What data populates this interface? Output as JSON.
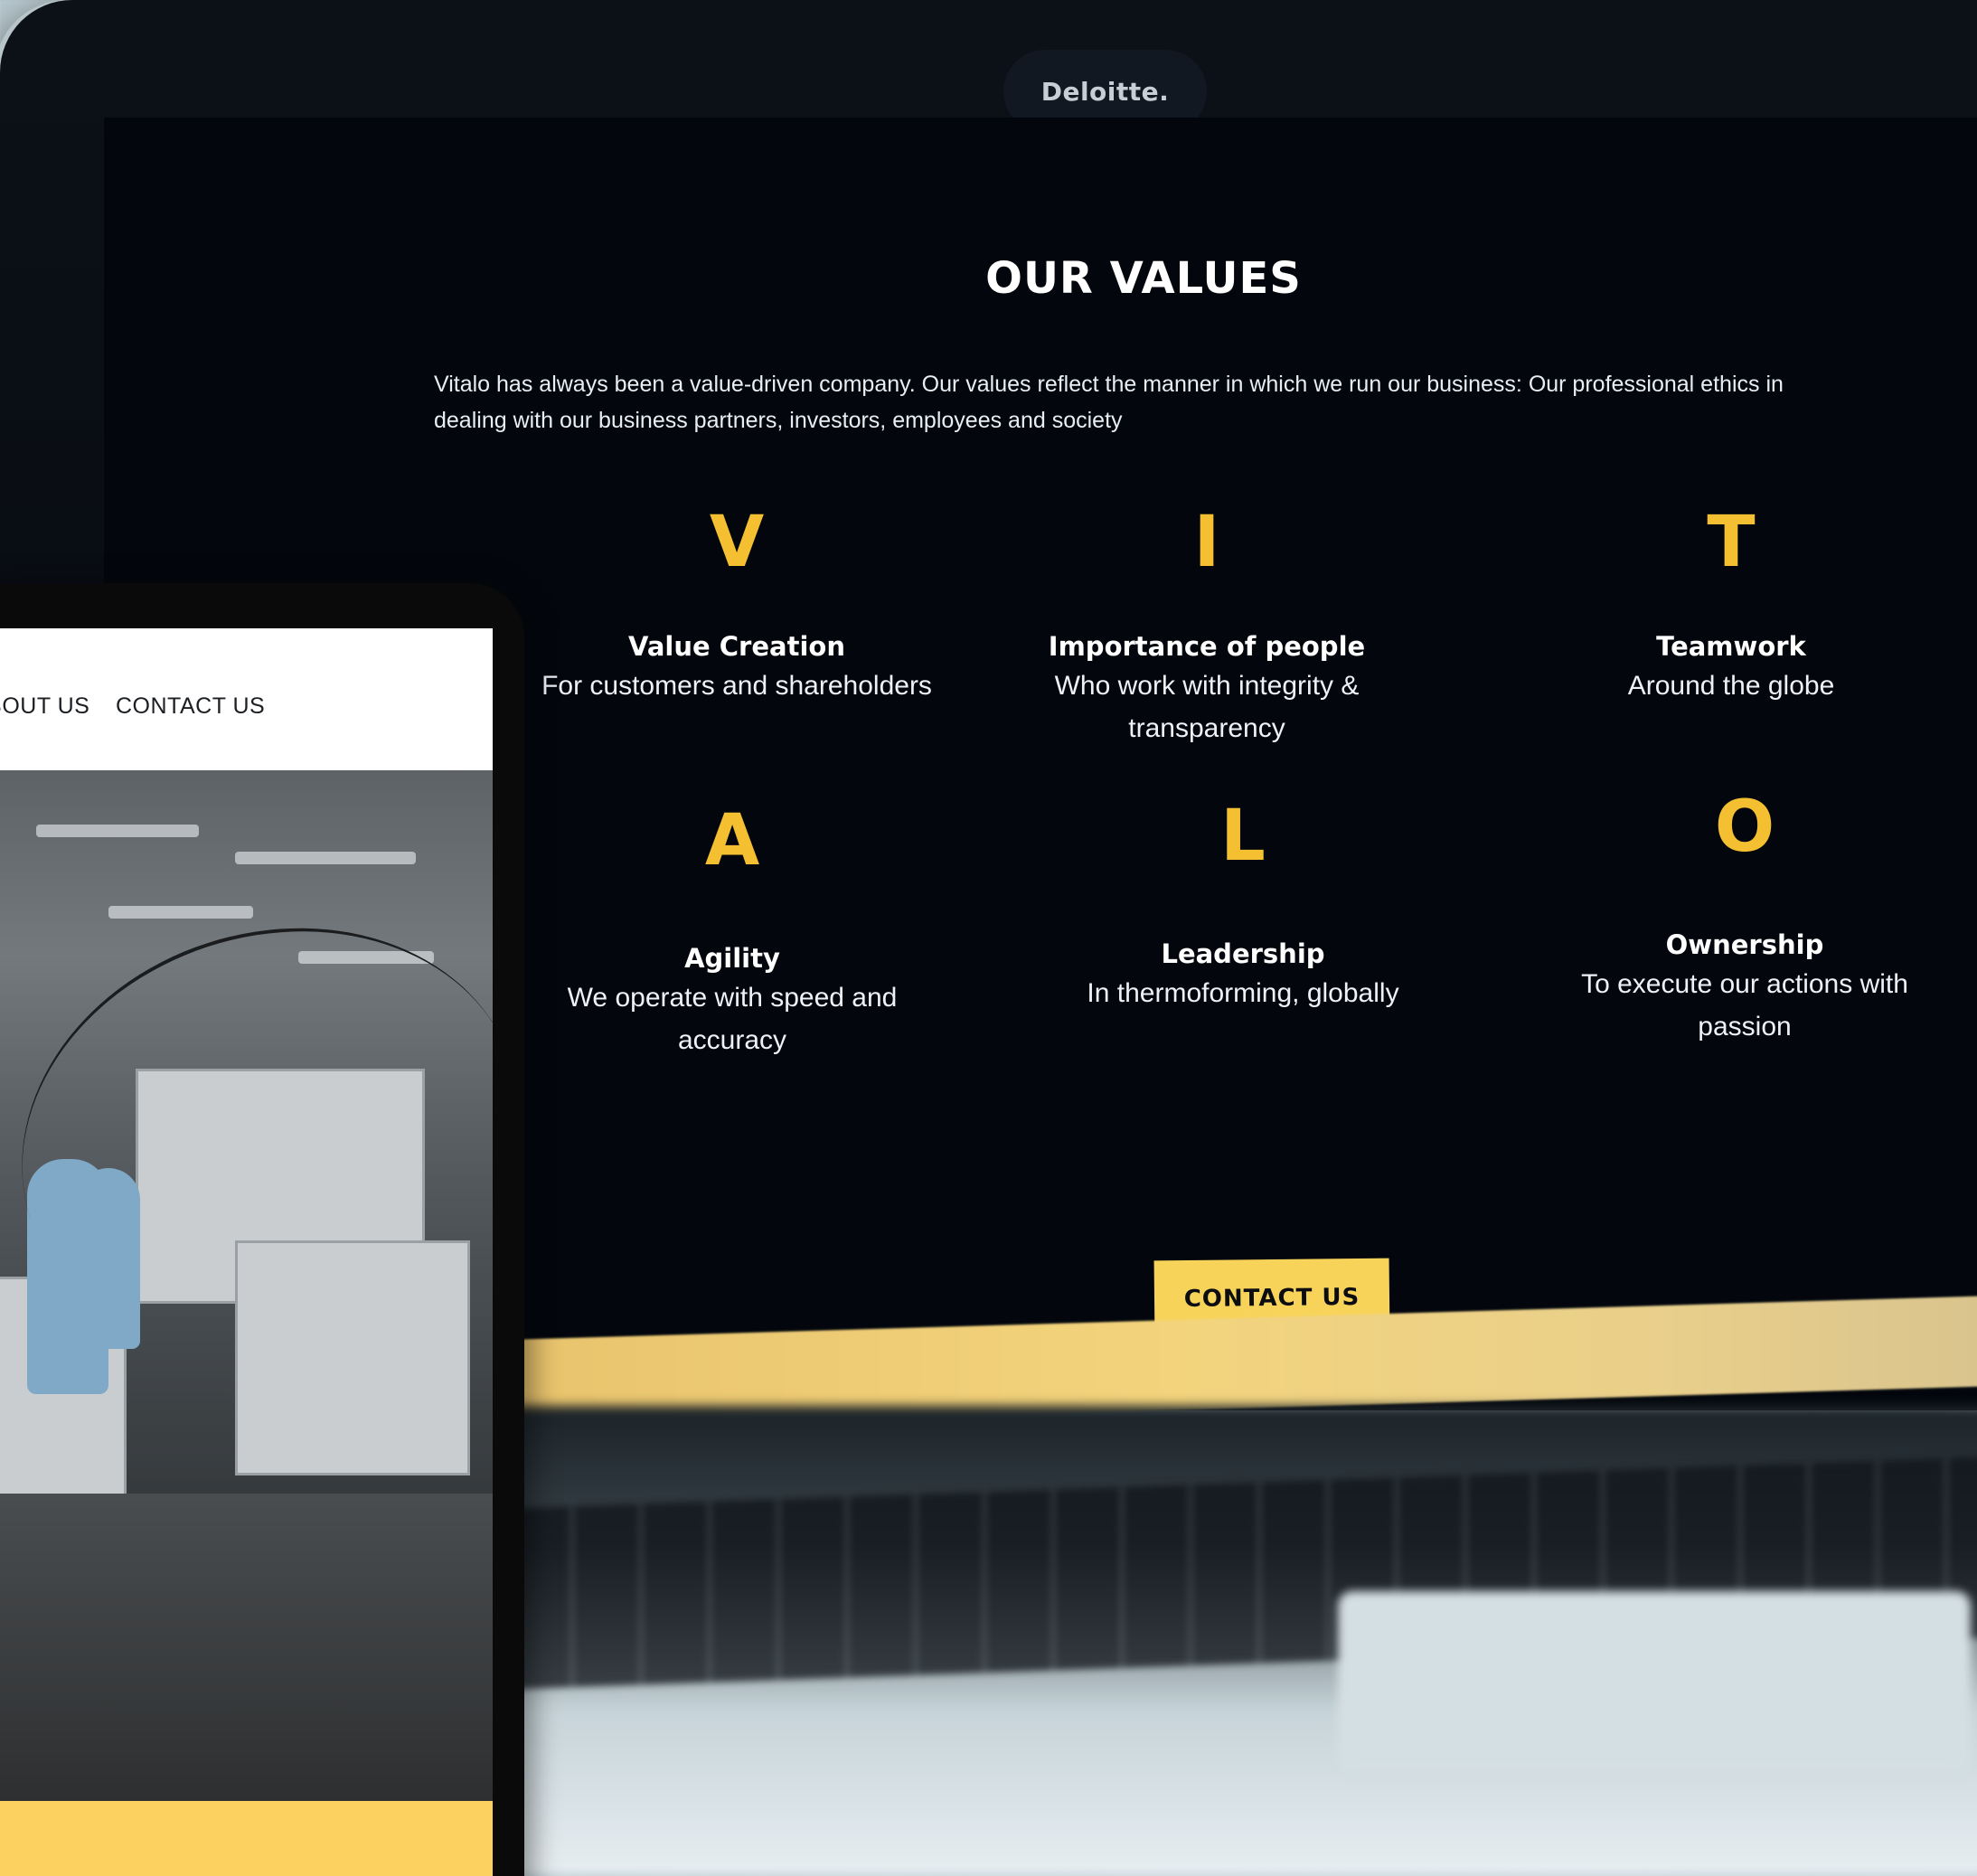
{
  "laptop": {
    "brand": "Deloitte.",
    "title": "OUR VALUES",
    "intro": "Vitalo has always been a value-driven company. Our values reflect the manner in which we run our business: Our professional ethics in dealing with our business partners, investors, employees and society",
    "values": [
      {
        "letter": "V",
        "heading": "Value Creation",
        "desc": "For customers and shareholders"
      },
      {
        "letter": "I",
        "heading": "Importance of people",
        "desc": "Who work with integrity & transparency"
      },
      {
        "letter": "T",
        "heading": "Teamwork",
        "desc": "Around the globe"
      },
      {
        "letter": "A",
        "heading": "Agility",
        "desc": "We operate with speed and accuracy"
      },
      {
        "letter": "L",
        "heading": "Leadership",
        "desc": "In thermoforming, globally"
      },
      {
        "letter": "O",
        "heading": "Ownership",
        "desc": "To execute our actions with passion"
      }
    ],
    "cta_label": "CONTACT US"
  },
  "tablet": {
    "nav": [
      "ABOUT US",
      "CONTACT US"
    ]
  },
  "colors": {
    "accent": "#f5bf32",
    "button": "#f8d35a",
    "screen_bg": "#03070d"
  }
}
